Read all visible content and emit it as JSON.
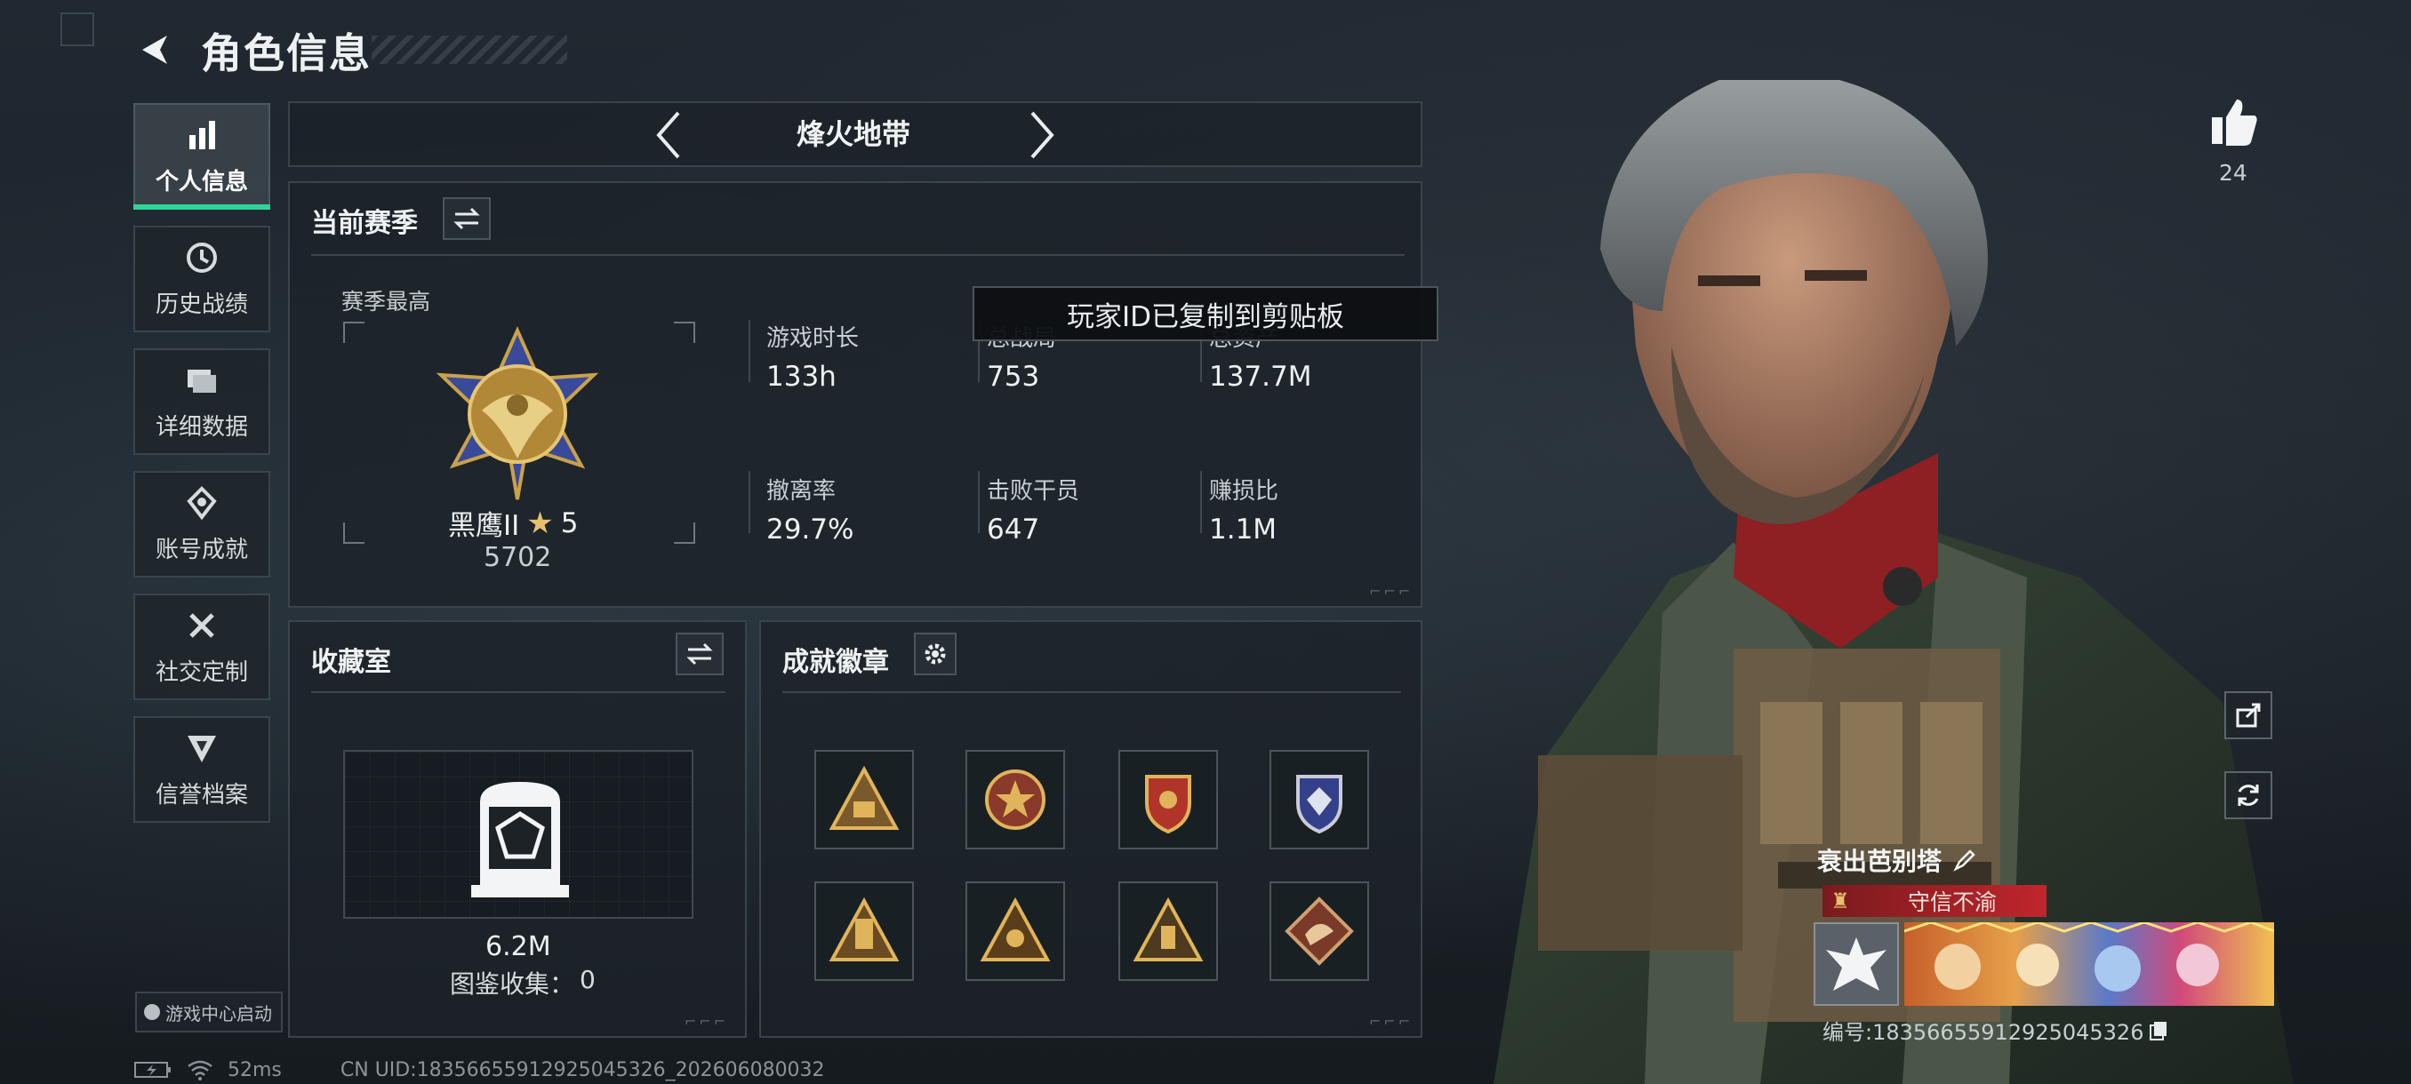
{
  "header": {
    "title": "角色信息"
  },
  "nav": {
    "items": [
      {
        "label": "个人信息",
        "icon": "bar-chart-icon",
        "active": true
      },
      {
        "label": "历史战绩",
        "icon": "history-icon",
        "active": false
      },
      {
        "label": "详细数据",
        "icon": "folder-icon",
        "active": false
      },
      {
        "label": "账号成就",
        "icon": "achievement-icon",
        "active": false
      },
      {
        "label": "社交定制",
        "icon": "tools-icon",
        "active": false
      },
      {
        "label": "信誉档案",
        "icon": "reputation-icon",
        "active": false
      }
    ],
    "game_center_label": "游戏中心启动"
  },
  "mode_bar": {
    "name": "烽火地带"
  },
  "season": {
    "title": "当前赛季",
    "best_label": "赛季最高",
    "rank_name": "黑鹰II",
    "rank_stars": "5",
    "rank_points": "5702",
    "stats": [
      {
        "label": "游戏时长",
        "value": "133h"
      },
      {
        "label": "总战局",
        "value": "753"
      },
      {
        "label": "总资产",
        "value": "137.7M"
      },
      {
        "label": "撤离率",
        "value": "29.7%"
      },
      {
        "label": "击败干员",
        "value": "647"
      },
      {
        "label": "赚损比",
        "value": "1.1M"
      }
    ]
  },
  "toast": {
    "text": "玩家ID已复制到剪贴板"
  },
  "collection": {
    "title": "收藏室",
    "value": "6.2M",
    "catalog_label": "图鉴收集：",
    "catalog_count": "0"
  },
  "badges": {
    "title": "成就徽章",
    "items": [
      "pyramid-badge-icon",
      "star-seal-badge-icon",
      "shield-crest-badge-icon",
      "blue-shield-badge-icon",
      "tower-badge-icon",
      "eye-triangle-badge-icon",
      "relic-triangle-badge-icon",
      "dragon-diamond-badge-icon"
    ]
  },
  "profile": {
    "likes": "24",
    "player_name": "衰出芭别塔",
    "title_tag": "守信不渝",
    "id_label": "编号:18356655912925045326"
  },
  "status": {
    "ping": "52ms",
    "uid_text": "CN UID:18356655912925045326_202606080032"
  },
  "colors": {
    "accent": "#2fd39a",
    "panel_border": "#3a444c",
    "title_tag_red": "#b8232a"
  }
}
